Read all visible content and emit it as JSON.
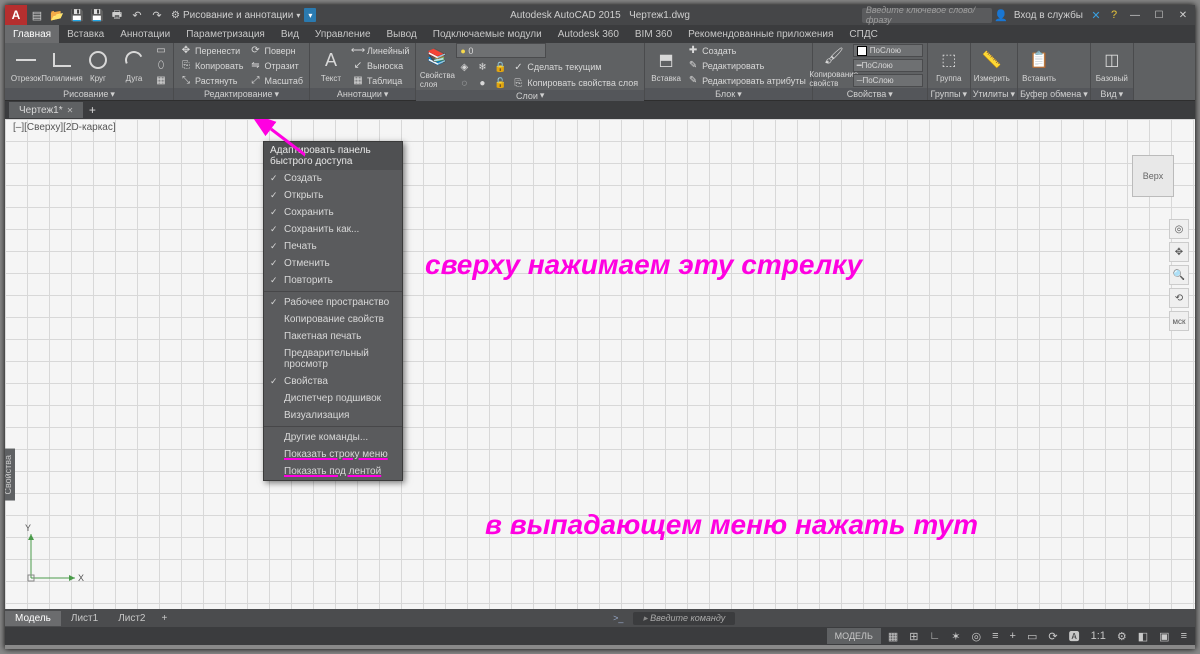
{
  "title": {
    "app": "Autodesk AutoCAD 2015",
    "doc": "Чертеж1.dwg"
  },
  "qat_workspace": "Рисование и аннотации",
  "search_placeholder": "Введите ключевое слово/фразу",
  "login_label": "Вход в службы",
  "win": {
    "min": "—",
    "max": "☐",
    "close": "✕"
  },
  "tabs": [
    "Главная",
    "Вставка",
    "Аннотации",
    "Параметризация",
    "Вид",
    "Управление",
    "Вывод",
    "Подключаемые модули",
    "Autodesk 360",
    "BIM 360",
    "Рекомендованные приложения",
    "СПДС"
  ],
  "panels": {
    "draw": {
      "title": "Рисование",
      "line": "Отрезок",
      "pline": "Полилиния",
      "circle": "Круг",
      "arc": "Дуга"
    },
    "modify": {
      "title": "Редактирование",
      "move": "Перенести",
      "copy": "Копировать",
      "stretch": "Растянуть",
      "rotate": "Поверн",
      "mirror": "Отразит",
      "scale": "Масштаб"
    },
    "anno": {
      "title": "Аннотации",
      "text": "Текст",
      "linear": "Линейный",
      "leader": "Выноска",
      "table": "Таблица"
    },
    "layers": {
      "title": "Слои",
      "props": "Свойства слоя",
      "sel": "0",
      "mkcur": "Сделать текущим",
      "match": "Копировать свойства слоя"
    },
    "block": {
      "title": "Блок",
      "insert": "Вставка",
      "create": "Создать",
      "edit": "Редактировать",
      "editattr": "Редактировать атрибуты"
    },
    "props": {
      "title": "Свойства",
      "match": "Копирование свойств",
      "bylayer": "ПоСлою"
    },
    "groups": {
      "title": "Группы",
      "group": "Группа"
    },
    "utils": {
      "title": "Утилиты",
      "measure": "Измерить"
    },
    "clip": {
      "title": "Буфер обмена",
      "paste": "Вставить"
    },
    "view": {
      "title": "Вид",
      "base": "Базовый"
    }
  },
  "filetab": "Чертеж1*",
  "viewlabel": "[–][Сверху][2D-каркас]",
  "sidebar": "Свойства",
  "viewcube": "Верх",
  "wcs": "мск",
  "axes": {
    "x": "X",
    "y": "Y"
  },
  "dropdown": {
    "title": "Адаптировать панель быстрого доступа",
    "items": [
      {
        "t": "Создать",
        "ck": true
      },
      {
        "t": "Открыть",
        "ck": true
      },
      {
        "t": "Сохранить",
        "ck": true
      },
      {
        "t": "Сохранить как...",
        "ck": true
      },
      {
        "t": "Печать",
        "ck": true
      },
      {
        "t": "Отменить",
        "ck": true
      },
      {
        "t": "Повторить",
        "ck": true
      }
    ],
    "items2": [
      {
        "t": "Рабочее пространство",
        "ck": true
      },
      {
        "t": "Копирование свойств",
        "ck": false
      },
      {
        "t": "Пакетная печать",
        "ck": false
      },
      {
        "t": "Предварительный просмотр",
        "ck": false
      },
      {
        "t": "Свойства",
        "ck": true
      },
      {
        "t": "Диспетчер подшивок",
        "ck": false
      },
      {
        "t": "Визуализация",
        "ck": false
      }
    ],
    "items3": [
      {
        "t": "Другие команды..."
      },
      {
        "t": "Показать строку меню",
        "hl": true
      },
      {
        "t": "Показать под лентой",
        "hl": true
      }
    ]
  },
  "anno1": "сверху нажимаем эту стрелку",
  "anno2": "в выпадающем меню нажать тут",
  "layouts": [
    "Модель",
    "Лист1",
    "Лист2"
  ],
  "cmd_prompt": "Введите команду",
  "status_model": "МОДЕЛЬ"
}
